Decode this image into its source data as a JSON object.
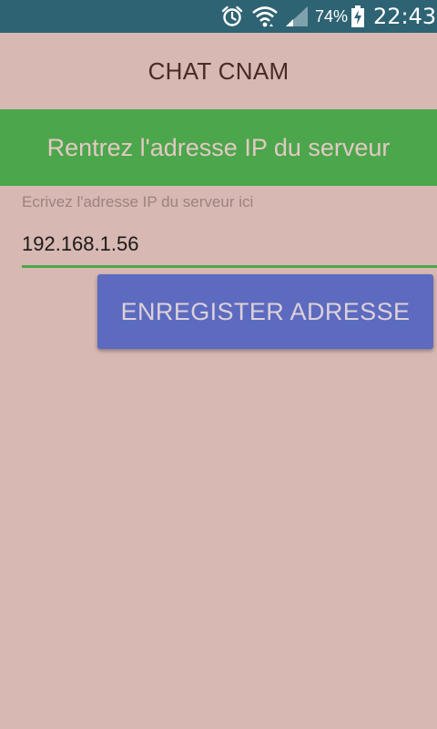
{
  "status_bar": {
    "icons": [
      "alarm-icon",
      "wifi-icon",
      "cellular-signal-icon",
      "battery-charging-icon"
    ],
    "battery_percent": "74%",
    "time": "22:43"
  },
  "app": {
    "title": "CHAT CNAM"
  },
  "banner": {
    "text": "Rentrez l'adresse IP du serveur"
  },
  "ip_field": {
    "label": "Ecrivez l'adresse IP du serveur ici",
    "value": "192.168.1.56"
  },
  "save_button": {
    "label": "ENREGISTER ADRESSE"
  },
  "colors": {
    "background": "#D8B8B2",
    "status_bar": "#2E6373",
    "banner": "#4CA64B",
    "button": "#5C6BC0"
  }
}
